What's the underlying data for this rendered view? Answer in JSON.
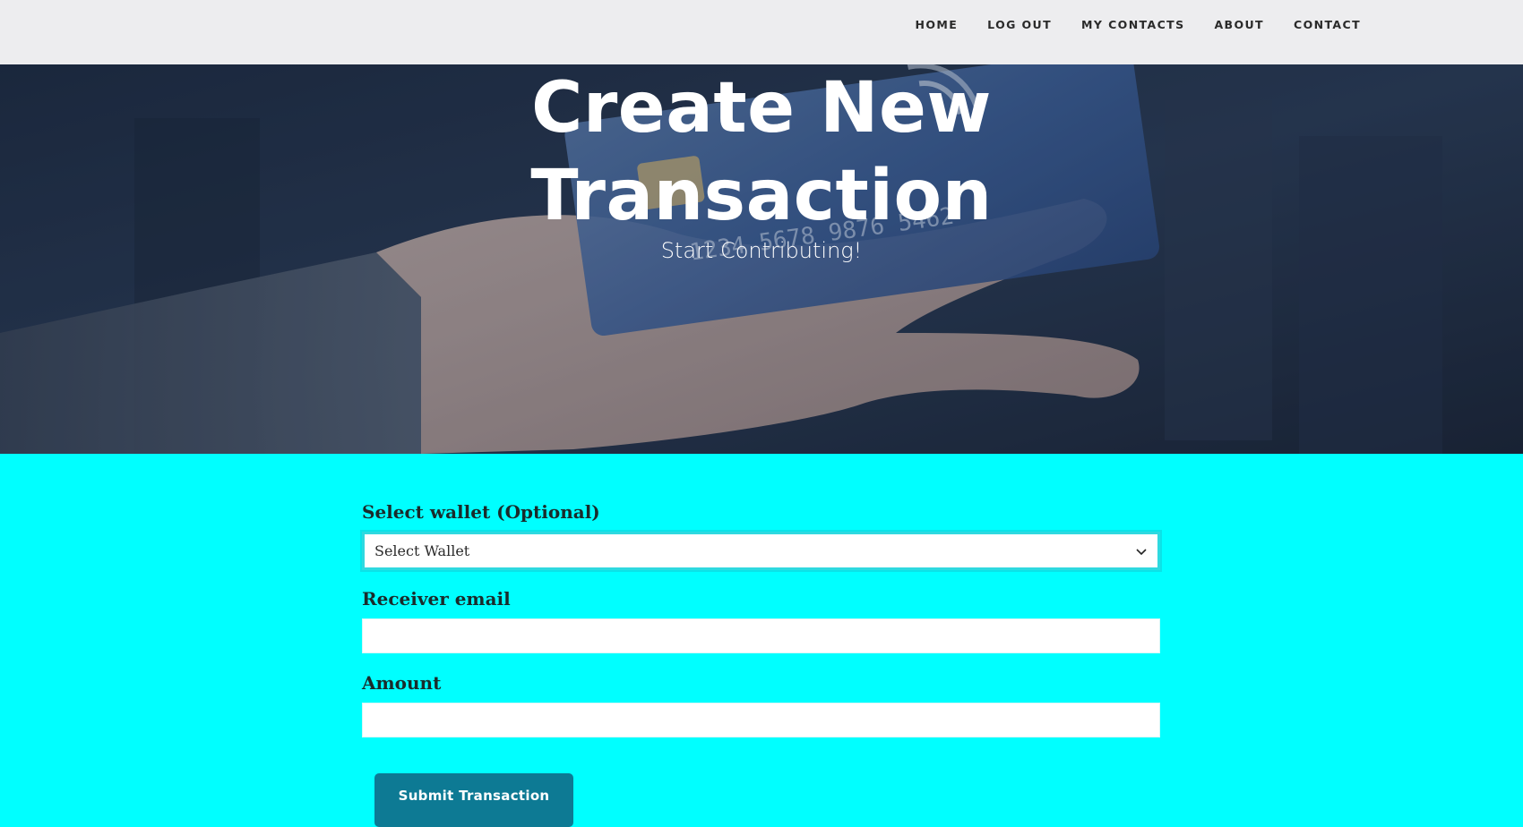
{
  "nav": {
    "items": [
      {
        "label": "HOME"
      },
      {
        "label": "LOG OUT"
      },
      {
        "label": "MY CONTACTS"
      },
      {
        "label": "ABOUT"
      },
      {
        "label": "CONTACT"
      }
    ]
  },
  "hero": {
    "title_line1": "Create New",
    "title_line2": "Transaction",
    "subtitle": "Start Contributing!",
    "image_icon": "credit-card-in-hand-image"
  },
  "form": {
    "wallet": {
      "label": "Select wallet (Optional)",
      "selected": "Select Wallet"
    },
    "receiver": {
      "label": "Receiver email",
      "value": "",
      "placeholder": ""
    },
    "amount": {
      "label": "Amount",
      "value": "",
      "placeholder": ""
    },
    "submit_label": "Submit Transaction"
  },
  "colors": {
    "page_background": "#00ffff",
    "navbar_background": "#ededef",
    "button_background": "#0d7a94",
    "select_focus_border": "#2fd9e0"
  }
}
